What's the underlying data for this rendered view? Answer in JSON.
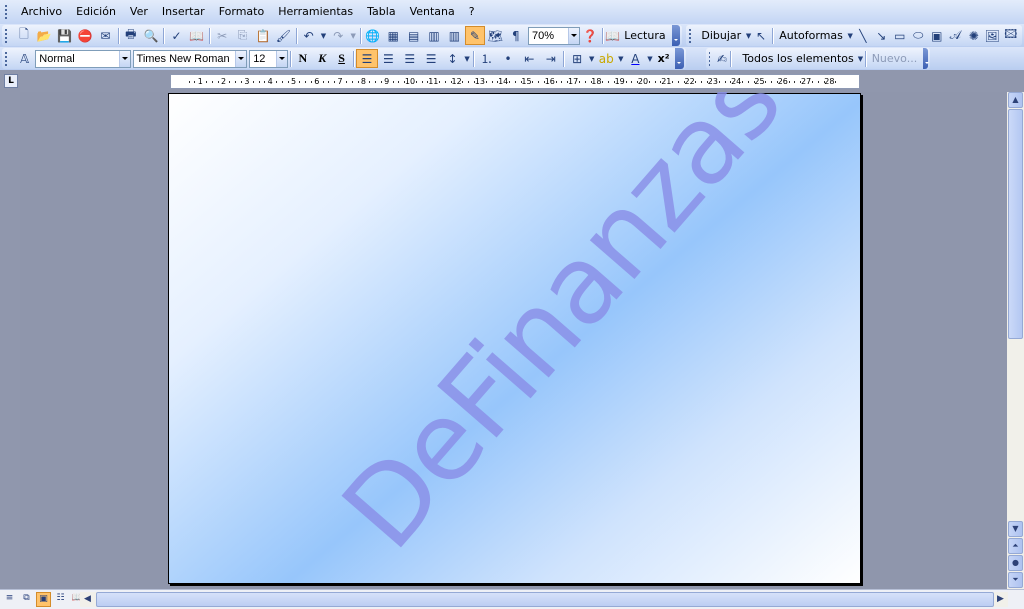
{
  "menu": [
    {
      "key": "archivo",
      "label": "Archivo"
    },
    {
      "key": "edicion",
      "label": "Edición"
    },
    {
      "key": "ver",
      "label": "Ver"
    },
    {
      "key": "insertar",
      "label": "Insertar"
    },
    {
      "key": "formato",
      "label": "Formato"
    },
    {
      "key": "herramientas",
      "label": "Herramientas"
    },
    {
      "key": "tabla",
      "label": "Tabla"
    },
    {
      "key": "ventana",
      "label": "Ventana"
    },
    {
      "key": "ayuda",
      "label": "?"
    }
  ],
  "standard_toolbar": {
    "zoom": "70%",
    "reading_label": "Lectura"
  },
  "drawing_toolbar": {
    "draw_label": "Dibujar",
    "autoshapes_label": "Autoformas"
  },
  "format_toolbar": {
    "style": "Normal",
    "font": "Times New Roman",
    "size": "12",
    "bold": "N",
    "italic": "K",
    "underline": "S",
    "superscript": "x²"
  },
  "style_toolbar": {
    "all_elements_label": "Todos los elementos",
    "new_label": "Nuevo..."
  },
  "ruler": {
    "ticks": [
      "1",
      "2",
      "3",
      "4",
      "5",
      "6",
      "7",
      "8",
      "9",
      "10",
      "11",
      "12",
      "13",
      "14",
      "15",
      "16",
      "17",
      "18",
      "19",
      "20",
      "21",
      "22",
      "23",
      "24",
      "25",
      "26",
      "27",
      "28"
    ]
  },
  "document": {
    "watermark": "DeFinanzas"
  },
  "colors": {
    "watermark": "#8a8fe8",
    "page_gradient_mid": "#97c6fb",
    "toolbar": "#c3d5f4"
  }
}
